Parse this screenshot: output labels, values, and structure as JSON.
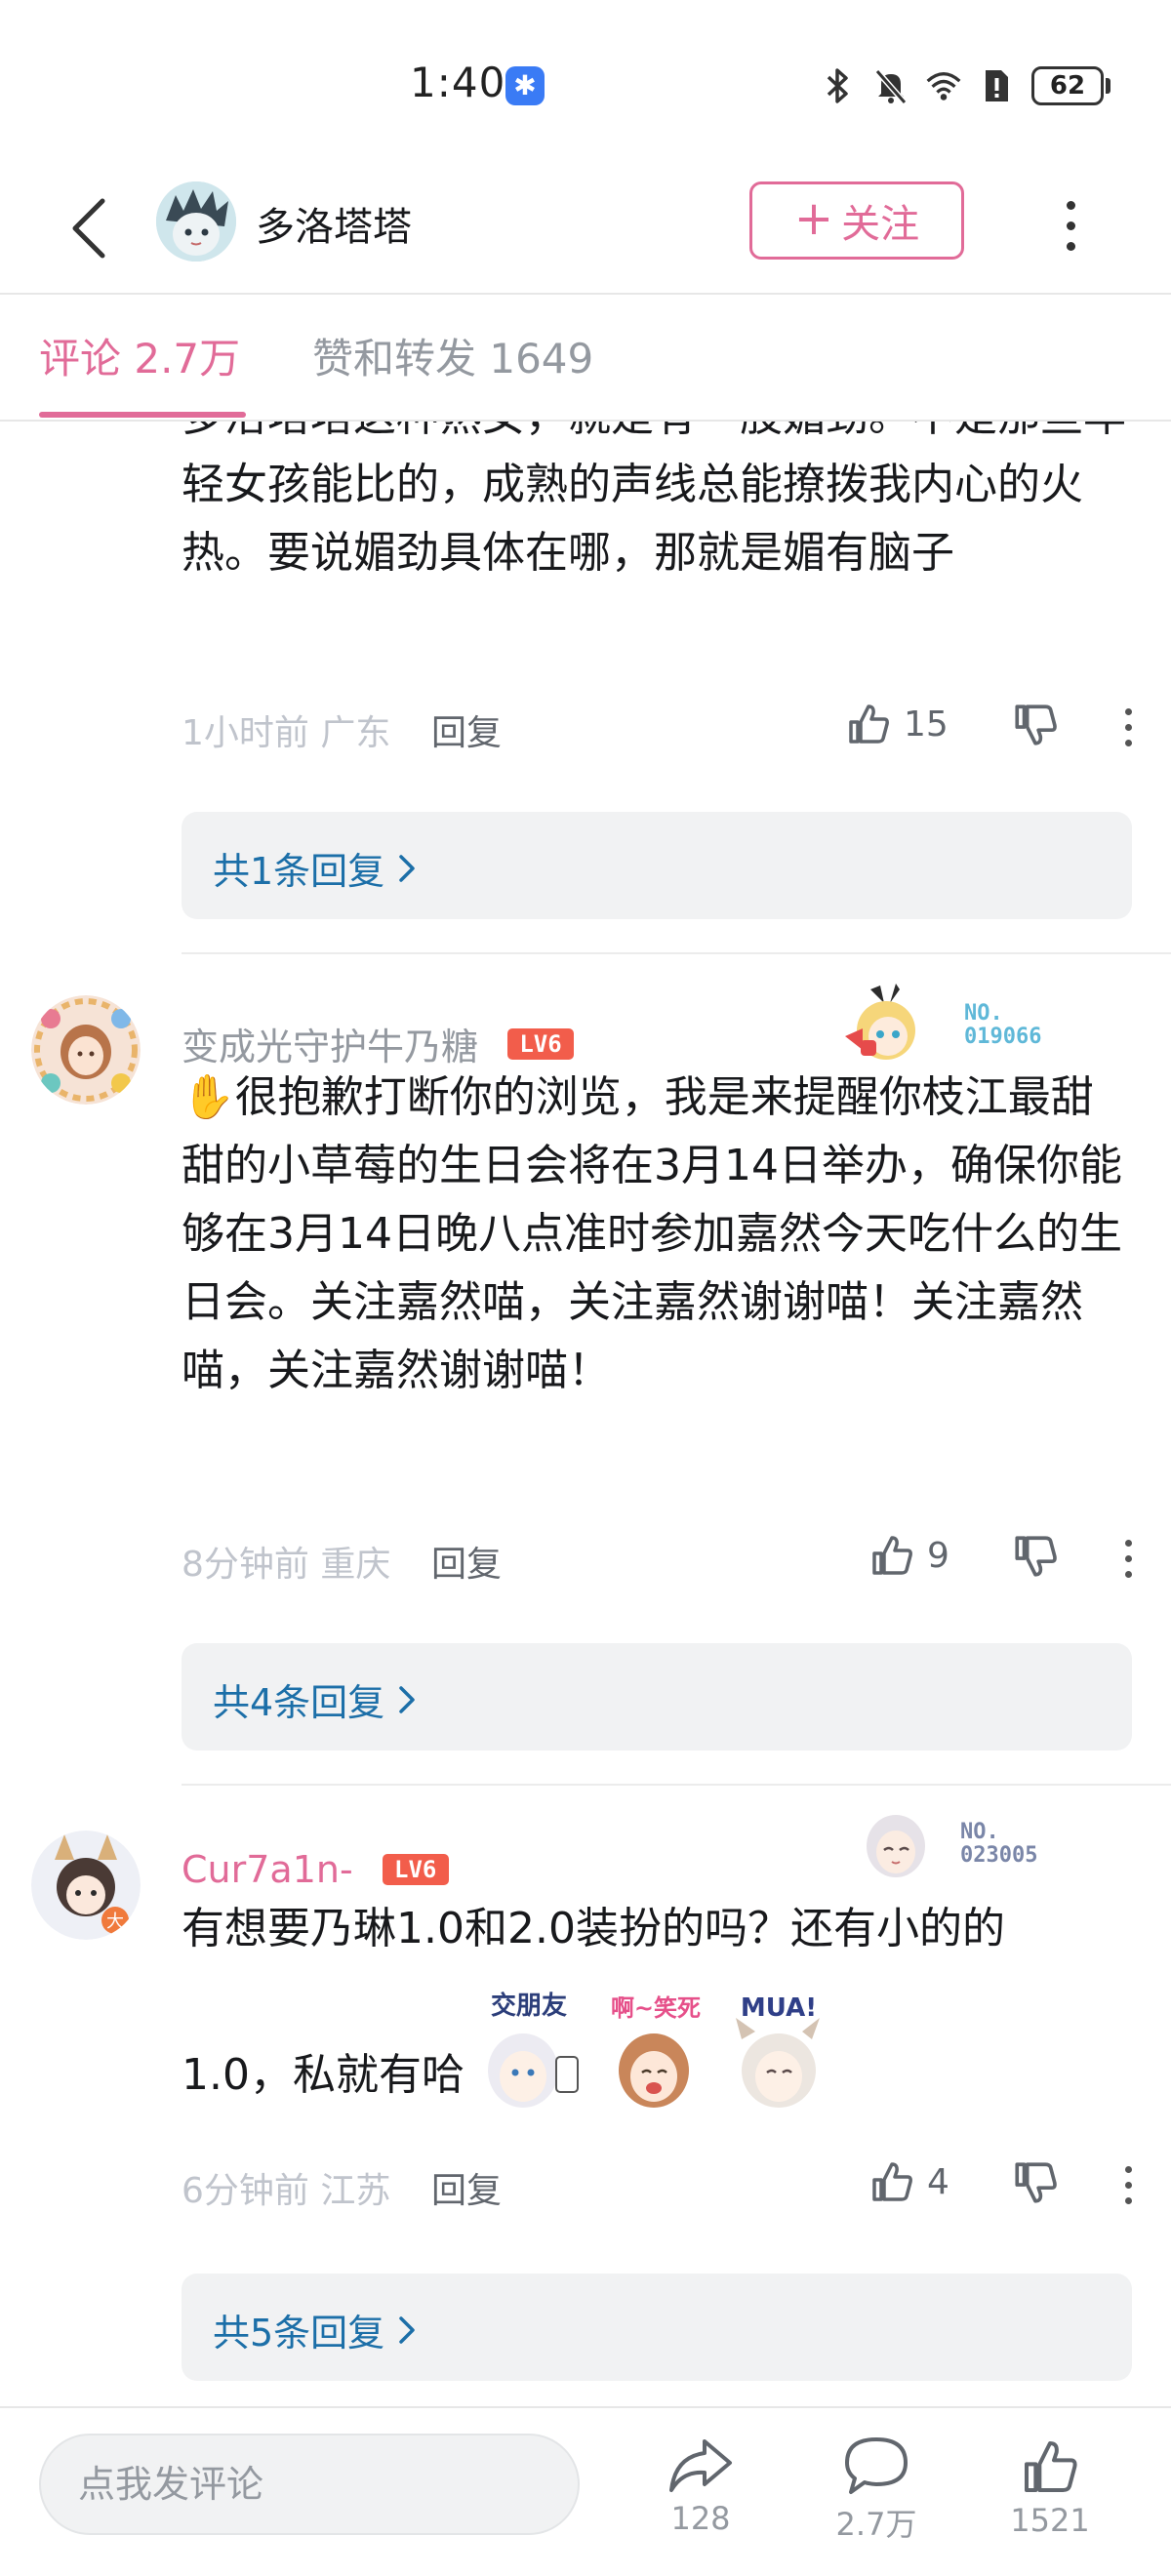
{
  "status_bar": {
    "time": "1:40",
    "battery": "62"
  },
  "header": {
    "username": "多洛塔塔",
    "follow_label": "关注"
  },
  "tabs": {
    "comments": "评论 2.7万",
    "likes_reposts": "赞和转发 1649"
  },
  "comments": [
    {
      "text": "多洛塔塔这种熟女，就是有一股媚劲。不是那些年轻女孩能比的，成熟的声线总能撩拨我内心的火热。要说媚劲具体在哪，那就是媚有脑子",
      "time_location": "1小时前 广东",
      "reply_label": "回复",
      "likes": "15",
      "replies_summary": "共1条回复"
    },
    {
      "username": "变成光守护牛乃糖",
      "level": "LV6",
      "fan_no": "NO.",
      "fan_id": "019066",
      "text": "✋很抱歉打断你的浏览，我是来提醒你枝江最甜甜的小草莓的生日会将在3月14日举办，确保你能够在3月14日晚八点准时参加嘉然今天吃什么的生日会。关注嘉然喵，关注嘉然谢谢喵！关注嘉然喵，关注嘉然谢谢喵！",
      "time_location": "8分钟前 重庆",
      "reply_label": "回复",
      "likes": "9",
      "replies_summary": "共4条回复"
    },
    {
      "username": "Cur7a1n-",
      "level": "LV6",
      "fan_no": "NO.",
      "fan_id": "023005",
      "text_line1": "有想要乃琳1.0和2.0装扮的吗？还有小的的",
      "text_line2": "1.0，私就有哈",
      "stickers": [
        "交朋友",
        "啊~笑死",
        "MUA!"
      ],
      "time_location": "6分钟前 江苏",
      "reply_label": "回复",
      "likes": "4",
      "replies_summary": "共5条回复"
    }
  ],
  "bottom_bar": {
    "input_placeholder": "点我发评论",
    "share_count": "128",
    "comment_count": "2.7万",
    "like_count": "1521"
  },
  "colors": {
    "accent_pink": "#e16b98",
    "link_blue": "#1c6fa8",
    "level_red": "#f25d4b"
  }
}
